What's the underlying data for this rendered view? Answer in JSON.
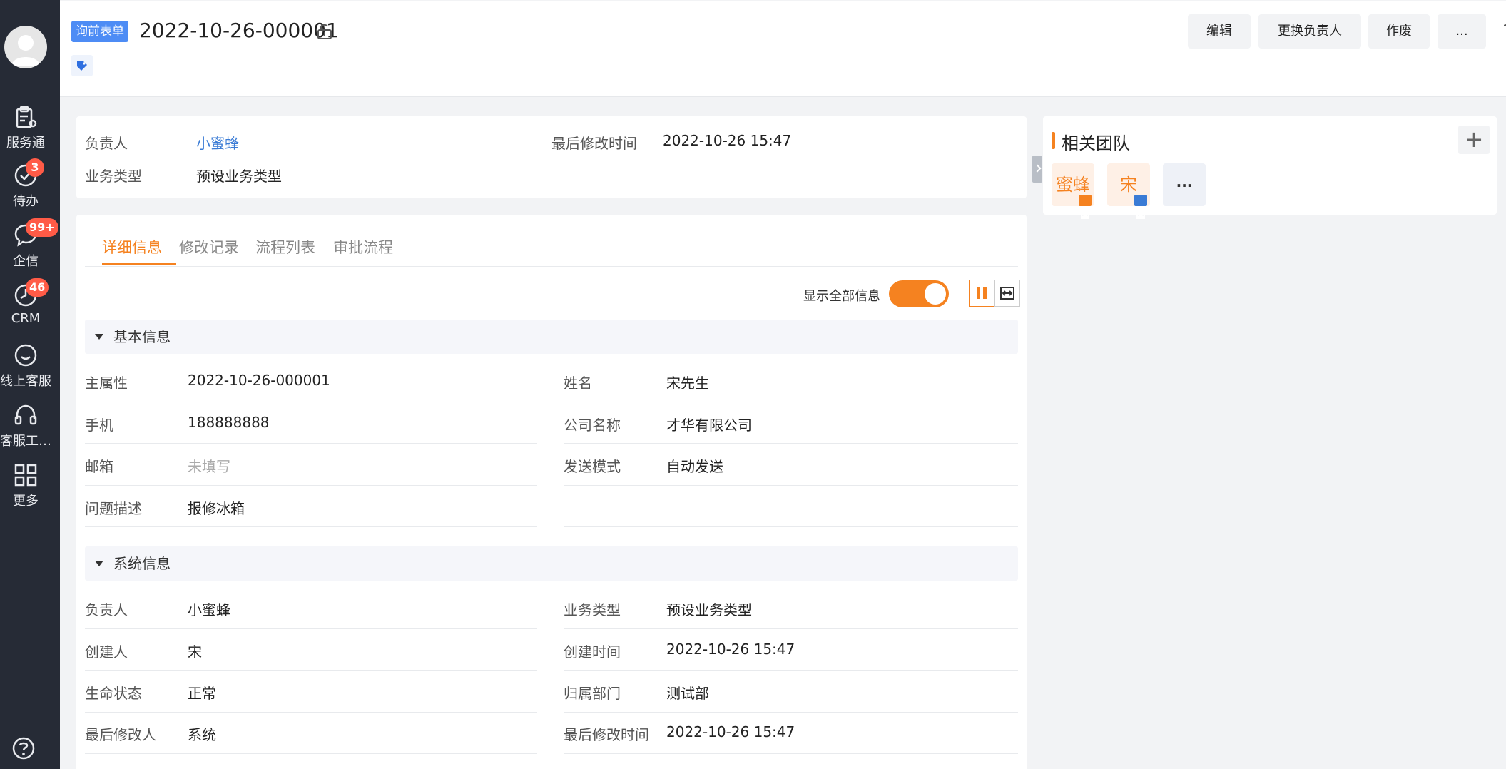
{
  "sidebar": {
    "items": [
      {
        "label": "服务通",
        "icon": "service-clipboard-icon"
      },
      {
        "label": "待办",
        "icon": "check-circle-icon",
        "badge": "3"
      },
      {
        "label": "企信",
        "icon": "chat-bubble-icon",
        "badge": "99+"
      },
      {
        "label": "CRM",
        "icon": "clock-icon",
        "badge": "46"
      },
      {
        "label": "线上客服",
        "icon": "smile-chat-icon"
      },
      {
        "label": "客服工…",
        "icon": "headset-icon"
      },
      {
        "label": "更多",
        "icon": "grid-icon"
      }
    ]
  },
  "header": {
    "tag": "询前表单",
    "title": "2022-10-26-000001",
    "buttons": {
      "edit": "编辑",
      "change_owner": "更换负责人",
      "void": "作废",
      "more": "..."
    }
  },
  "summary": {
    "owner_label": "负责人",
    "owner_value": "小蜜蜂",
    "modified_label": "最后修改时间",
    "modified_value": "2022-10-26 15:47",
    "biz_label": "业务类型",
    "biz_value": "预设业务类型"
  },
  "tabs": [
    "详细信息",
    "修改记录",
    "流程列表",
    "审批流程"
  ],
  "show_all_label": "显示全部信息",
  "sections": {
    "basic": {
      "title": "基本信息",
      "fields": [
        {
          "label": "主属性",
          "value": "2022-10-26-000001"
        },
        {
          "label": "姓名",
          "value": "宋先生"
        },
        {
          "label": "手机",
          "value": "188888888"
        },
        {
          "label": "公司名称",
          "value": "才华有限公司"
        },
        {
          "label": "邮箱",
          "value": "未填写"
        },
        {
          "label": "发送模式",
          "value": "自动发送"
        },
        {
          "label": "问题描述",
          "value": "报修冰箱"
        }
      ]
    },
    "system": {
      "title": "系统信息",
      "fields": [
        {
          "label": "负责人",
          "value": "小蜜蜂"
        },
        {
          "label": "业务类型",
          "value": "预设业务类型"
        },
        {
          "label": "创建人",
          "value": "宋"
        },
        {
          "label": "创建时间",
          "value": "2022-10-26 15:47"
        },
        {
          "label": "生命状态",
          "value": "正常"
        },
        {
          "label": "归属部门",
          "value": "测试部"
        },
        {
          "label": "最后修改人",
          "value": "系统"
        },
        {
          "label": "最后修改时间",
          "value": "2022-10-26 15:47"
        }
      ]
    }
  },
  "team": {
    "title": "相关团队",
    "add": "+",
    "members": [
      {
        "name": "蜜蜂",
        "crown_color": "#f58220"
      },
      {
        "name": "宋",
        "crown_color": "#3a7bd5"
      }
    ],
    "more": "..."
  },
  "colors": {
    "accent": "#f58220",
    "link": "#3a7bd5",
    "sidebar": "#262b36",
    "tag": "#4d8cf5"
  }
}
